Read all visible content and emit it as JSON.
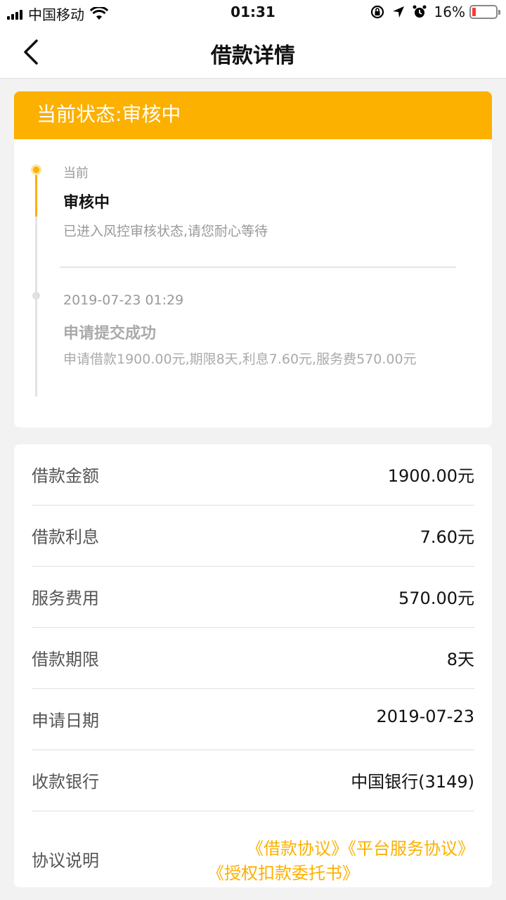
{
  "status_bar": {
    "carrier": "中国移动",
    "time": "01:31",
    "battery_percent": "16%",
    "battery_level": 0.16,
    "battery_color": "#ff3b30"
  },
  "nav": {
    "title": "借款详情",
    "back_icon": "chevron-left-icon"
  },
  "status": {
    "header": "当前状态:审核中",
    "accent_color": "#fcb000",
    "events": [
      {
        "label": "当前",
        "title": "审核中",
        "desc": "已进入风控审核状态,请您耐心等待"
      },
      {
        "label": "2019-07-23 01:29",
        "title": "申请提交成功",
        "desc": "申请借款1900.00元,期限8天,利息7.60元,服务费570.00元"
      }
    ]
  },
  "details": {
    "rows": [
      {
        "label": "借款金额",
        "value": "1900.00元"
      },
      {
        "label": "借款利息",
        "value": "7.60元"
      },
      {
        "label": "服务费用",
        "value": "570.00元"
      },
      {
        "label": "借款期限",
        "value": "8天"
      },
      {
        "label": "申请日期",
        "value": "2019-07-23"
      },
      {
        "label": "收款银行",
        "value": "中国银行(3149)"
      }
    ],
    "agreement": {
      "label": "协议说明",
      "links": [
        "《借款协议》",
        "《平台服务协议》",
        "《授权扣款委托书》"
      ]
    }
  }
}
